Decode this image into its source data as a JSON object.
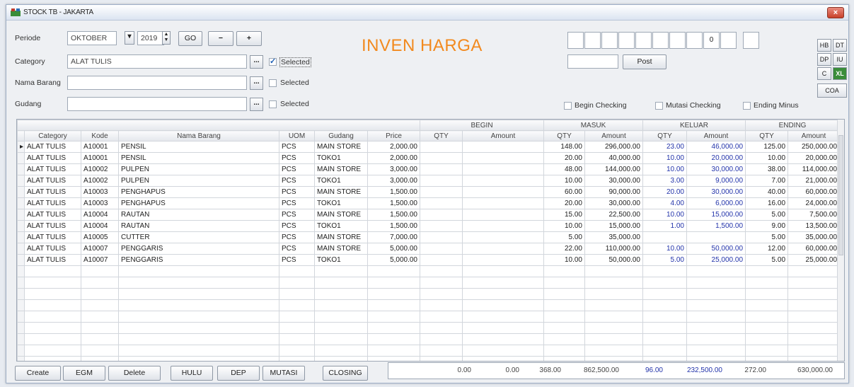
{
  "window": {
    "title": "STOCK TB - JAKARTA",
    "close_label": "×"
  },
  "form": {
    "periode_label": "Periode",
    "month_value": "OKTOBER",
    "year_value": "2019",
    "go_label": "GO",
    "minus_label": "−",
    "plus_label": "+",
    "category_label": "Category",
    "category_value": "ALAT TULIS",
    "nama_barang_label": "Nama Barang",
    "nama_barang_value": "",
    "gudang_label": "Gudang",
    "gudang_value": "",
    "browse_label": "...",
    "selected_label": "Selected",
    "selected_category_checked": true,
    "selected_nama_checked": false,
    "selected_gudang_checked": false
  },
  "header": {
    "big_title": "INVEN HARGA",
    "entry_boxes": [
      "",
      "",
      "",
      "",
      "",
      "",
      "",
      "",
      "0",
      "",
      ""
    ],
    "post_field_value": "",
    "post_label": "Post",
    "side_buttons": [
      "HB",
      "DT",
      "DP",
      "IU",
      "C",
      "XL"
    ],
    "coa_label": "COA",
    "begin_checking_label": "Begin Checking",
    "mutasi_checking_label": "Mutasi Checking",
    "ending_minus_label": "Ending Minus"
  },
  "grid": {
    "groups": [
      "BEGIN",
      "MASUK",
      "KELUAR",
      "ENDING"
    ],
    "columns": [
      "Category",
      "Kode",
      "Nama Barang",
      "UOM",
      "Gudang",
      "Price",
      "QTY",
      "Amount",
      "QTY",
      "Amount",
      "QTY",
      "Amount",
      "QTY",
      "Amount"
    ],
    "rows": [
      [
        "ALAT TULIS",
        "A10001",
        "PENSIL",
        "PCS",
        "MAIN STORE",
        "2,000.00",
        "",
        "",
        "148.00",
        "296,000.00",
        "23.00",
        "46,000.00",
        "125.00",
        "250,000.00"
      ],
      [
        "ALAT TULIS",
        "A10001",
        "PENSIL",
        "PCS",
        "TOKO1",
        "2,000.00",
        "",
        "",
        "20.00",
        "40,000.00",
        "10.00",
        "20,000.00",
        "10.00",
        "20,000.00"
      ],
      [
        "ALAT TULIS",
        "A10002",
        "PULPEN",
        "PCS",
        "MAIN STORE",
        "3,000.00",
        "",
        "",
        "48.00",
        "144,000.00",
        "10.00",
        "30,000.00",
        "38.00",
        "114,000.00"
      ],
      [
        "ALAT TULIS",
        "A10002",
        "PULPEN",
        "PCS",
        "TOKO1",
        "3,000.00",
        "",
        "",
        "10.00",
        "30,000.00",
        "3.00",
        "9,000.00",
        "7.00",
        "21,000.00"
      ],
      [
        "ALAT TULIS",
        "A10003",
        "PENGHAPUS",
        "PCS",
        "MAIN STORE",
        "1,500.00",
        "",
        "",
        "60.00",
        "90,000.00",
        "20.00",
        "30,000.00",
        "40.00",
        "60,000.00"
      ],
      [
        "ALAT TULIS",
        "A10003",
        "PENGHAPUS",
        "PCS",
        "TOKO1",
        "1,500.00",
        "",
        "",
        "20.00",
        "30,000.00",
        "4.00",
        "6,000.00",
        "16.00",
        "24,000.00"
      ],
      [
        "ALAT TULIS",
        "A10004",
        "RAUTAN",
        "PCS",
        "MAIN STORE",
        "1,500.00",
        "",
        "",
        "15.00",
        "22,500.00",
        "10.00",
        "15,000.00",
        "5.00",
        "7,500.00"
      ],
      [
        "ALAT TULIS",
        "A10004",
        "RAUTAN",
        "PCS",
        "TOKO1",
        "1,500.00",
        "",
        "",
        "10.00",
        "15,000.00",
        "1.00",
        "1,500.00",
        "9.00",
        "13,500.00"
      ],
      [
        "ALAT TULIS",
        "A10005",
        "CUTTER",
        "PCS",
        "MAIN STORE",
        "7,000.00",
        "",
        "",
        "5.00",
        "35,000.00",
        "",
        "",
        "5.00",
        "35,000.00"
      ],
      [
        "ALAT TULIS",
        "A10007",
        "PENGGARIS",
        "PCS",
        "MAIN STORE",
        "5,000.00",
        "",
        "",
        "22.00",
        "110,000.00",
        "10.00",
        "50,000.00",
        "12.00",
        "60,000.00"
      ],
      [
        "ALAT TULIS",
        "A10007",
        "PENGGARIS",
        "PCS",
        "TOKO1",
        "5,000.00",
        "",
        "",
        "10.00",
        "50,000.00",
        "5.00",
        "25,000.00",
        "5.00",
        "25,000.00"
      ]
    ],
    "empty_rows": 9
  },
  "totals": [
    "0.00",
    "0.00",
    "368.00",
    "862,500.00",
    "96.00",
    "232,500.00",
    "272.00",
    "630,000.00"
  ],
  "footer": {
    "buttons": [
      "Create",
      "EGM",
      "Delete",
      "HULU",
      "DEP",
      "MUTASI",
      "CLOSING"
    ]
  }
}
